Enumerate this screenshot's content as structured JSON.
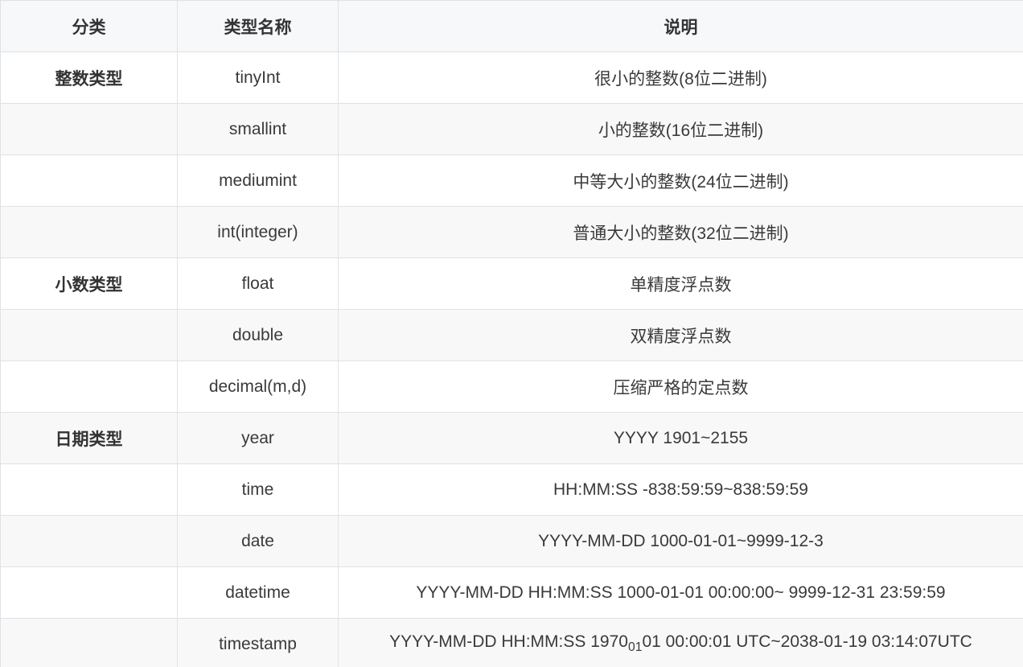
{
  "table": {
    "headers": [
      "分类",
      "类型名称",
      "说明"
    ],
    "rows": [
      {
        "category": "整数类型",
        "type": "tinyInt",
        "desc": "很小的整数(8位二进制)"
      },
      {
        "category": "",
        "type": "smallint",
        "desc": "小的整数(16位二进制)"
      },
      {
        "category": "",
        "type": "mediumint",
        "desc": "中等大小的整数(24位二进制)"
      },
      {
        "category": "",
        "type": "int(integer)",
        "desc": "普通大小的整数(32位二进制)"
      },
      {
        "category": "小数类型",
        "type": "float",
        "desc": "单精度浮点数"
      },
      {
        "category": "",
        "type": "double",
        "desc": "双精度浮点数"
      },
      {
        "category": "",
        "type": "decimal(m,d)",
        "desc": "压缩严格的定点数"
      },
      {
        "category": "日期类型",
        "type": "year",
        "desc": "YYYY 1901~2155"
      },
      {
        "category": "",
        "type": "time",
        "desc": "HH:MM:SS -838:59:59~838:59:59"
      },
      {
        "category": "",
        "type": "date",
        "desc": "YYYY-MM-DD 1000-01-01~9999-12-3"
      },
      {
        "category": "",
        "type": "datetime",
        "desc": "YYYY-MM-DD HH:MM:SS 1000-01-01 00:00:00~ 9999-12-31 23:59:59"
      },
      {
        "category": "",
        "type": "timestamp",
        "desc_parts": [
          "YYYY-MM-DD HH:MM:SS 1970",
          "01",
          "01 00:00:01 UTC~2038-01-19 03:14:07UTC"
        ]
      }
    ]
  }
}
